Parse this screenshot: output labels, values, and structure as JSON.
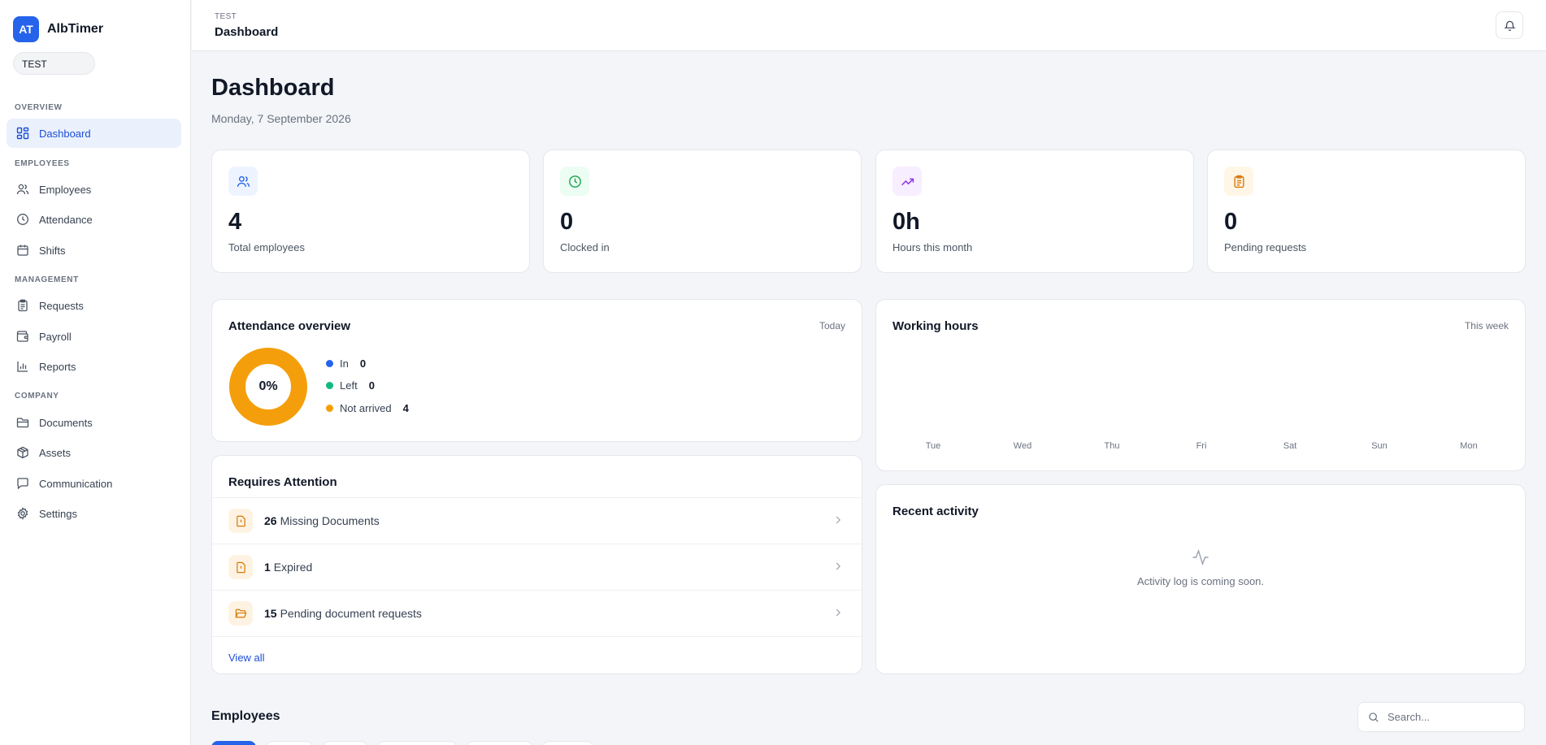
{
  "brand": {
    "logo_text": "AT",
    "name": "AlbTimer",
    "org": "TEST"
  },
  "nav": {
    "sections": [
      "OVERVIEW",
      "EMPLOYEES",
      "MANAGEMENT",
      "COMPANY"
    ],
    "items": [
      {
        "label": "Dashboard",
        "icon": "grid-icon"
      },
      {
        "label": "Employees",
        "icon": "users-icon"
      },
      {
        "label": "Attendance",
        "icon": "clock-icon"
      },
      {
        "label": "Shifts",
        "icon": "calendar-icon"
      },
      {
        "label": "Requests",
        "icon": "clipboard-icon"
      },
      {
        "label": "Payroll",
        "icon": "wallet-icon"
      },
      {
        "label": "Reports",
        "icon": "bar-chart-icon"
      },
      {
        "label": "Documents",
        "icon": "folder-icon"
      },
      {
        "label": "Assets",
        "icon": "box-icon"
      },
      {
        "label": "Communication",
        "icon": "message-icon"
      },
      {
        "label": "Settings",
        "icon": "gear-icon"
      }
    ]
  },
  "topbar": {
    "crumb_small": "TEST",
    "crumb_main": "Dashboard"
  },
  "page": {
    "title": "Dashboard",
    "date": "Monday, 7 September 2026"
  },
  "stats": [
    {
      "value": "4",
      "label": "Total employees",
      "icon": "users-icon",
      "color": "#2563eb"
    },
    {
      "value": "0",
      "label": "Clocked in",
      "icon": "clock-icon",
      "color": "#16a34a"
    },
    {
      "value": "0h",
      "label": "Hours this month",
      "icon": "trending-up-icon",
      "color": "#9333ea"
    },
    {
      "value": "0",
      "label": "Pending requests",
      "icon": "clipboard-icon",
      "color": "#d97706"
    }
  ],
  "attendance": {
    "title": "Attendance overview",
    "meta": "Today",
    "percent": "0%",
    "legend": [
      {
        "label": "In",
        "value": "0",
        "color": "#2563eb"
      },
      {
        "label": "Left",
        "value": "0",
        "color": "#10b981"
      },
      {
        "label": "Not arrived",
        "value": "4",
        "color": "#f59e0b"
      }
    ]
  },
  "working_hours": {
    "title": "Working hours",
    "meta": "This week",
    "days": [
      "Tue",
      "Wed",
      "Thu",
      "Fri",
      "Sat",
      "Sun",
      "Mon"
    ]
  },
  "attention": {
    "title": "Requires Attention",
    "items": [
      {
        "count": "26",
        "label": "Missing Documents",
        "icon": "file-alert-icon"
      },
      {
        "count": "1",
        "label": "Expired",
        "icon": "file-alert-icon"
      },
      {
        "count": "15",
        "label": "Pending document requests",
        "icon": "folder-open-icon"
      }
    ],
    "view_all": "View all"
  },
  "activity": {
    "title": "Recent activity",
    "empty_text": "Activity log is coming soon."
  },
  "employees": {
    "title": "Employees",
    "search_placeholder": "Search..."
  }
}
